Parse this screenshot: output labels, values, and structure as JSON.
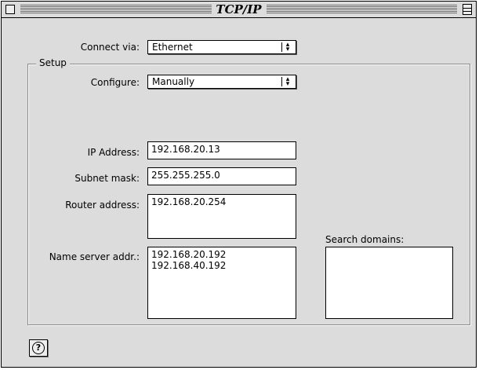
{
  "window": {
    "title": "TCP/IP"
  },
  "connect_via": {
    "label": "Connect via:",
    "value": "Ethernet"
  },
  "setup": {
    "group_label": "Setup",
    "configure": {
      "label": "Configure:",
      "value": "Manually"
    },
    "ip_address": {
      "label": "IP Address:",
      "value": "192.168.20.13"
    },
    "subnet_mask": {
      "label": "Subnet mask:",
      "value": "255.255.255.0"
    },
    "router_address": {
      "label": "Router address:",
      "value": "192.168.20.254"
    },
    "name_server": {
      "label": "Name server addr.:",
      "value": "192.168.20.192\n192.168.40.192"
    },
    "search_domains": {
      "label": "Search domains:",
      "value": ""
    }
  },
  "help": {
    "icon": "help-icon",
    "glyph": "?"
  }
}
